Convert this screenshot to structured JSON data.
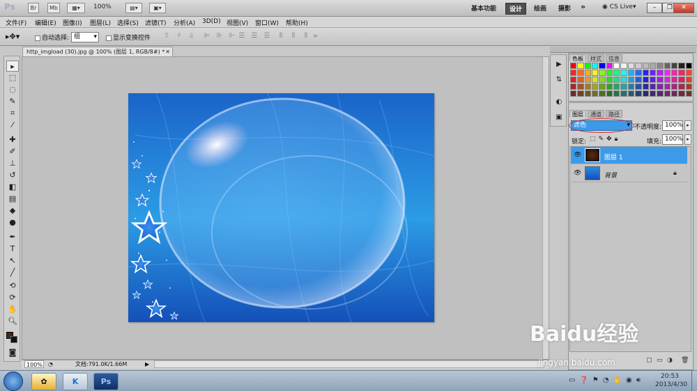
{
  "app": {
    "logo": "Ps",
    "mini_buttons": [
      "Br",
      "Mb"
    ],
    "zoom": "100%",
    "workspaces": [
      "基本功能",
      "设计",
      "绘画",
      "摄影"
    ],
    "more": "»",
    "cs_live": "CS Live"
  },
  "menu": [
    "文件(F)",
    "编辑(E)",
    "图像(I)",
    "图层(L)",
    "选择(S)",
    "滤镜(T)",
    "分析(A)",
    "3D(D)",
    "视图(V)",
    "窗口(W)",
    "帮助(H)"
  ],
  "options": {
    "auto_select_label": "自动选择:",
    "auto_select_value": "组",
    "show_transform_label": "显示变换控件"
  },
  "document": {
    "tab_title": "http_imgload (30).jpg @ 100% (图层 1, RGB/8#) *"
  },
  "status": {
    "zoom": "100%",
    "doc_info": "文档:791.0K/1.66M"
  },
  "panels": {
    "swatches_tabs": [
      "色板",
      "样式",
      "信息"
    ],
    "layers_tabs": [
      "图层",
      "通道",
      "路径"
    ],
    "blend_mode": "滤色",
    "opacity_label": "不透明度:",
    "opacity": "100%",
    "lock_label": "锁定:",
    "fill_label": "填充:",
    "fill": "100%",
    "layers": [
      {
        "name": "图层 1",
        "selected": true
      },
      {
        "name": "背景",
        "selected": false
      }
    ]
  },
  "watermark": {
    "brand": "Baidu经验",
    "url": "jingyan.baidu.com"
  },
  "taskbar": {
    "time": "20:53",
    "date": "2013/4/30"
  },
  "colors": {
    "foreground": "#4a2a12",
    "background": "#111111",
    "selection": "#3a9ae8"
  }
}
